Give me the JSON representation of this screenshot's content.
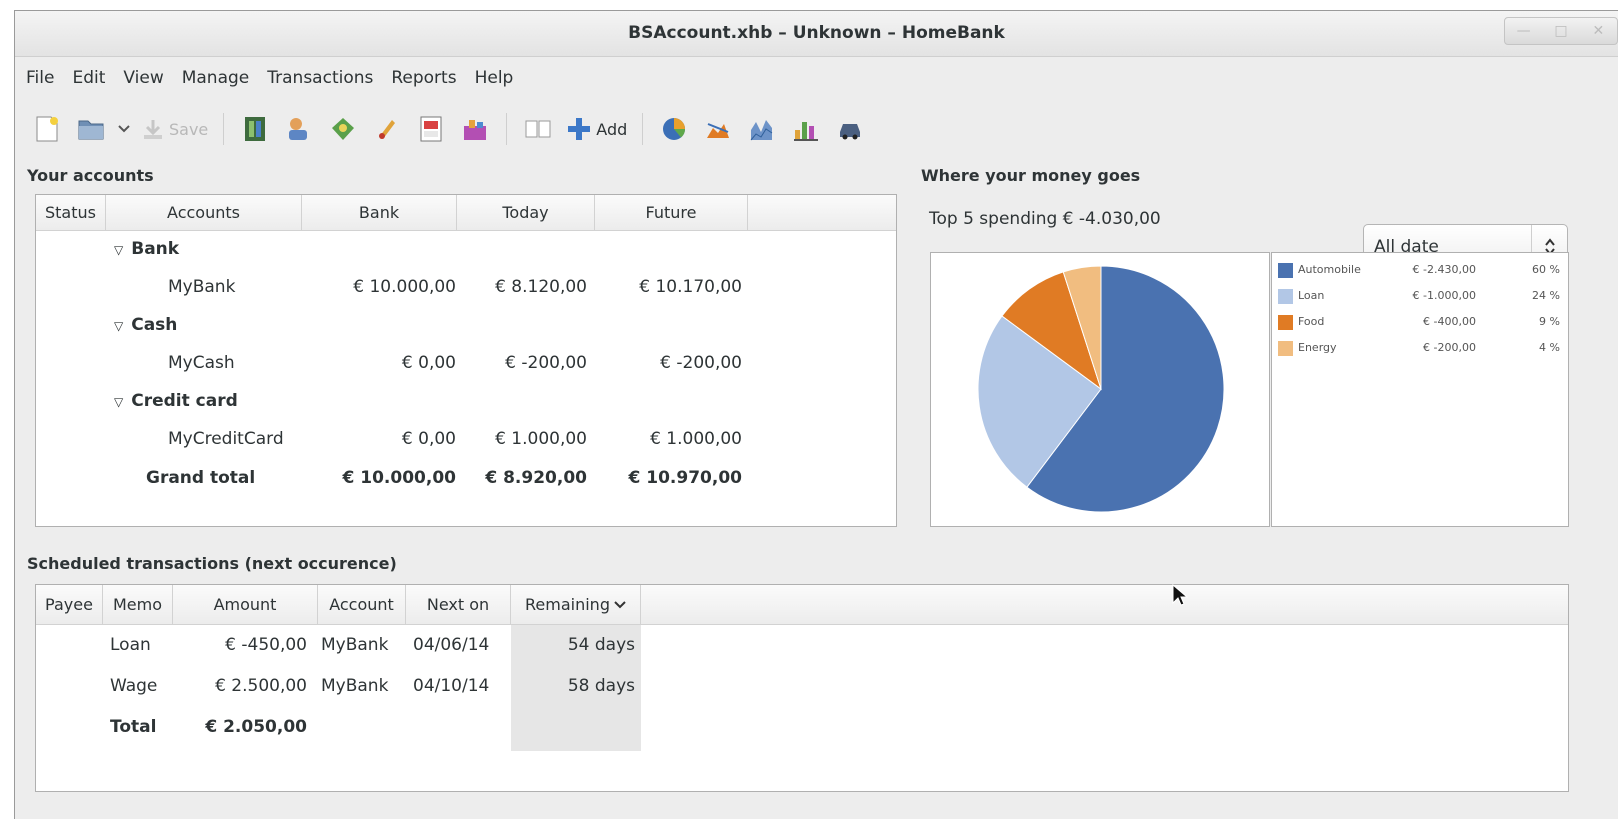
{
  "window": {
    "title": "BSAccount.xhb – Unknown – HomeBank"
  },
  "menu": [
    "File",
    "Edit",
    "View",
    "Manage",
    "Transactions",
    "Reports",
    "Help"
  ],
  "toolbar": {
    "save_label": "Save",
    "add_label": "Add"
  },
  "accounts": {
    "section_title": "Your accounts",
    "columns": [
      "Status",
      "Accounts",
      "Bank",
      "Today",
      "Future"
    ],
    "groups": [
      {
        "name": "Bank",
        "accounts": [
          {
            "name": "MyBank",
            "bank": "€ 10.000,00",
            "today": "€ 8.120,00",
            "future": "€ 10.170,00"
          }
        ]
      },
      {
        "name": "Cash",
        "accounts": [
          {
            "name": "MyCash",
            "bank": "€ 0,00",
            "today": "€ -200,00",
            "future": "€ -200,00"
          }
        ]
      },
      {
        "name": "Credit card",
        "accounts": [
          {
            "name": "MyCreditCard",
            "bank": "€ 0,00",
            "today": "€ 1.000,00",
            "future": "€ 1.000,00"
          }
        ]
      }
    ],
    "grand_total": {
      "label": "Grand total",
      "bank": "€ 10.000,00",
      "today": "€ 8.920,00",
      "future": "€ 10.970,00"
    }
  },
  "spending": {
    "section_title": "Where your money goes",
    "summary": "Top 5 spending € -4.030,00",
    "range_select": "All date",
    "legend": [
      {
        "name": "Automobile",
        "amount": "€ -2.430,00",
        "percent": "60 %",
        "color": "#4a72b0"
      },
      {
        "name": "Loan",
        "amount": "€ -1.000,00",
        "percent": "24 %",
        "color": "#b2c7e6"
      },
      {
        "name": "Food",
        "amount": "€ -400,00",
        "percent": "9 %",
        "color": "#e07b24"
      },
      {
        "name": "Energy",
        "amount": "€ -200,00",
        "percent": "4 %",
        "color": "#f1bd80"
      }
    ]
  },
  "chart_data": {
    "type": "pie",
    "categories": [
      "Automobile",
      "Loan",
      "Food",
      "Energy"
    ],
    "values": [
      2430,
      1000,
      400,
      200
    ],
    "colors": [
      "#4a72b0",
      "#b2c7e6",
      "#e07b24",
      "#f1bd80"
    ],
    "title": "",
    "legend": "right"
  },
  "scheduled": {
    "section_title": "Scheduled transactions (next occurence)",
    "columns": [
      "Payee",
      "Memo",
      "Amount",
      "Account",
      "Next on",
      "Remaining"
    ],
    "rows": [
      {
        "memo": "Loan",
        "amount": "€ -450,00",
        "account": "MyBank",
        "next_on": "04/06/14",
        "remaining": "54 days"
      },
      {
        "memo": "Wage",
        "amount": "€ 2.500,00",
        "account": "MyBank",
        "next_on": "04/10/14",
        "remaining": "58 days"
      }
    ],
    "total": {
      "label": "Total",
      "amount": "€ 2.050,00"
    }
  }
}
